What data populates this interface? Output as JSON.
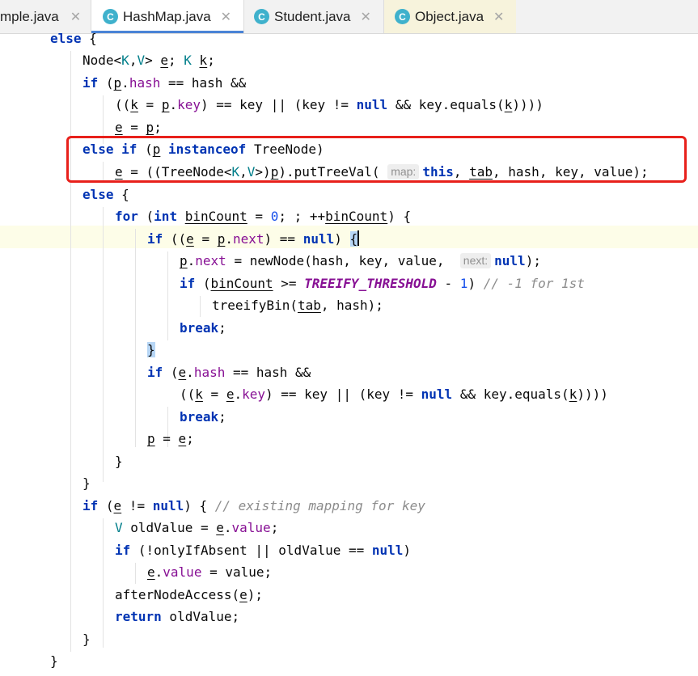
{
  "tabs": [
    {
      "label": "mple.java",
      "icon": "class-icon",
      "active": false
    },
    {
      "label": "HashMap.java",
      "icon": "class-icon",
      "active": true
    },
    {
      "label": "Student.java",
      "icon": "class-icon",
      "active": false
    },
    {
      "label": "Object.java",
      "icon": "class-icon",
      "active": false
    }
  ],
  "tab_icon_letter": "C",
  "close_glyph": "✕",
  "hints": {
    "map": "map:",
    "next": "next:"
  },
  "code": {
    "else_open": "else {",
    "node_decl": [
      "Node<",
      "K",
      ",",
      "V",
      "> ",
      "e",
      "; ",
      "K",
      " ",
      "k",
      ";"
    ],
    "if_p_hash": "if",
    "line_key_eq": "((k = p.key) == key || (key != null && key.equals(k))))",
    "e_eq_p": "e = p;",
    "else_if_treenode": "else if (p instanceof TreeNode)",
    "put_tree_val": "e = ((TreeNode<K,V>)p).putTreeVal(map: this, tab, hash, key, value);",
    "for_loop": "for (int binCount = 0; ; ++binCount) {",
    "if_next_null": "if ((e = p.next) == null) {",
    "new_node": "p.next = newNode(hash, key, value, next: null);",
    "if_treeify": "if (binCount >= TREEIFY_THRESHOLD - 1) // -1 for 1st",
    "treeify_bin": "treeifyBin(tab, hash);",
    "break": "break;",
    "close_brace": "}",
    "if_e_hash": "if (e.hash == hash &&",
    "line_e_key": "((k = e.key) == key || (key != null && key.equals(k))))",
    "p_eq_e": "p = e;",
    "if_e_not_null": "if (e != null) { // existing mapping for key",
    "old_value": "V oldValue = e.value;",
    "if_only_if_absent": "if (!onlyIfAbsent || oldValue == null)",
    "e_value_assign": "e.value = value;",
    "after_node_access": "afterNodeAccess(e);",
    "return_old": "return oldValue;"
  }
}
